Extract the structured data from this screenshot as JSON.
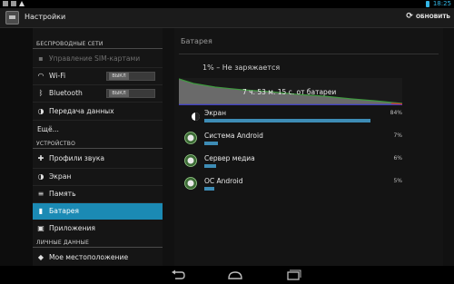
{
  "status_bar": {
    "time": "18:25"
  },
  "action_bar": {
    "title": "Настройки",
    "refresh_label": "ОБНОВИТЬ"
  },
  "sidebar": {
    "sections": [
      {
        "header": "БЕСПРОВОДНЫЕ СЕТИ"
      },
      {
        "header": "УСТРОЙСТВО"
      },
      {
        "header": "ЛИЧНЫЕ ДАННЫЕ"
      }
    ],
    "items": [
      {
        "label": "Управление SIM-картами",
        "icon": "sim-icon",
        "disabled": true
      },
      {
        "label": "Wi-Fi",
        "icon": "wifi-icon",
        "toggle": "ВЫКЛ"
      },
      {
        "label": "Bluetooth",
        "icon": "bluetooth-icon",
        "toggle": "ВЫКЛ"
      },
      {
        "label": "Передача данных",
        "icon": "data-usage-icon"
      },
      {
        "label": "Ещё...",
        "icon": ""
      },
      {
        "label": "Профили звука",
        "icon": "sound-icon"
      },
      {
        "label": "Экран",
        "icon": "display-icon"
      },
      {
        "label": "Память",
        "icon": "storage-icon"
      },
      {
        "label": "Батарея",
        "icon": "battery-icon",
        "active": true
      },
      {
        "label": "Приложения",
        "icon": "apps-icon"
      },
      {
        "label": "Мое местоположение",
        "icon": "location-icon"
      }
    ]
  },
  "battery": {
    "title": "Батарея",
    "status": "1% – Не заряжается",
    "graph_label": "7 ч. 53 м. 15 с. от батареи",
    "usage": [
      {
        "name": "Экран",
        "percent_text": "84%",
        "fraction": 0.84,
        "icon": "screen-brightness-icon"
      },
      {
        "name": "Система Android",
        "percent_text": "7%",
        "fraction": 0.07,
        "icon": "android-system-icon"
      },
      {
        "name": "Сервер медиа",
        "percent_text": "6%",
        "fraction": 0.06,
        "icon": "media-server-icon"
      },
      {
        "name": "ОС Android",
        "percent_text": "5%",
        "fraction": 0.05,
        "icon": "android-os-icon"
      }
    ]
  },
  "colors": {
    "accent": "#33b5e5",
    "active": "#1b8ab4",
    "bar": "#3d8cb5"
  }
}
